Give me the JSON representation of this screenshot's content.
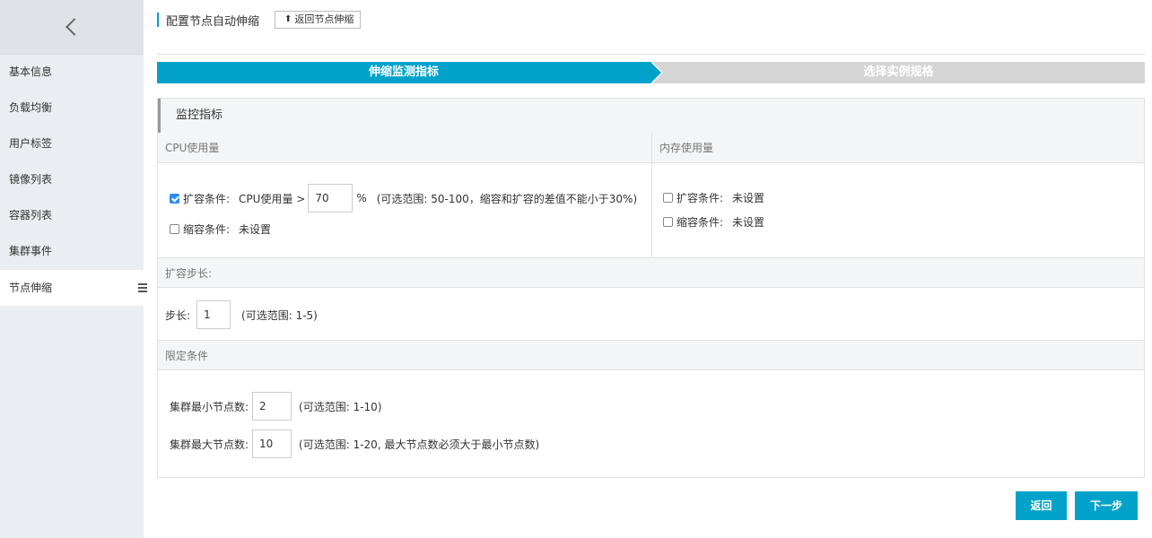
{
  "sidebar": {
    "items": [
      {
        "label": "基本信息"
      },
      {
        "label": "负载均衡"
      },
      {
        "label": "用户标签"
      },
      {
        "label": "镜像列表"
      },
      {
        "label": "容器列表"
      },
      {
        "label": "集群事件"
      },
      {
        "label": "节点伸缩"
      }
    ],
    "active": "节点伸缩"
  },
  "header": {
    "title": "配置节点自动伸缩",
    "back_link": "返回节点伸缩"
  },
  "steps": [
    {
      "label": "伸缩监测指标",
      "active": true
    },
    {
      "label": "选择实例规格",
      "active": false
    }
  ],
  "panel": {
    "title": "监控指标",
    "cpu": {
      "heading": "CPU使用量",
      "scale_up_label": "扩容条件:",
      "scale_up_checked": true,
      "scale_up_metric": "CPU使用量 >",
      "scale_up_value": "70",
      "unit": "%",
      "scale_up_hint": "(可选范围: 50-100，缩容和扩容的差值不能小于30%)",
      "scale_down_label": "缩容条件:",
      "scale_down_checked": false,
      "scale_down_value": "未设置"
    },
    "memory": {
      "heading": "内存使用量",
      "scale_up_label": "扩容条件:",
      "scale_up_checked": false,
      "scale_up_value": "未设置",
      "scale_down_label": "缩容条件:",
      "scale_down_checked": false,
      "scale_down_value": "未设置"
    },
    "step": {
      "heading": "扩容步长:",
      "label": "步长:",
      "value": "1",
      "hint": "(可选范围: 1-5)"
    },
    "limits": {
      "heading": "限定条件",
      "min_label": "集群最小节点数:",
      "min_value": "2",
      "min_hint": "(可选范围: 1-10)",
      "max_label": "集群最大节点数:",
      "max_value": "10",
      "max_hint": "(可选范围: 1-20, 最大节点数必须大于最小节点数)"
    }
  },
  "buttons": {
    "back": "返回",
    "next": "下一步"
  },
  "colors": {
    "accent": "#00a2ca",
    "inactive_step": "#d5d5d5",
    "sidebar_bg": "#eaedf1"
  }
}
